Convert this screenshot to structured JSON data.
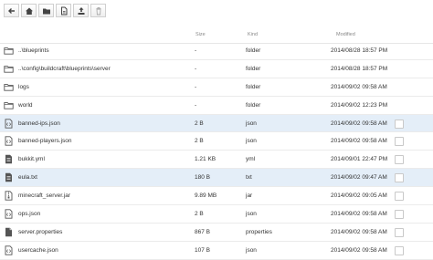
{
  "toolbar": {
    "buttons": [
      {
        "icon": "back-arrow-icon"
      },
      {
        "icon": "home-icon"
      },
      {
        "icon": "folder-icon"
      },
      {
        "icon": "new-file-icon"
      },
      {
        "icon": "upload-icon"
      },
      {
        "icon": "trash-icon"
      }
    ]
  },
  "columns": {
    "size": "Size",
    "kind": "Kind",
    "modified": "Modified"
  },
  "files": [
    {
      "name": "..\\blueprints",
      "size": "-",
      "kind": "folder",
      "modified": "2014/08/28 18:57 PM",
      "icon": "folder-icon",
      "highlighted": false,
      "has_checkbox": false
    },
    {
      "name": "..\\config\\buildcraft\\blueprints\\server",
      "size": "-",
      "kind": "folder",
      "modified": "2014/08/28 18:57 PM",
      "icon": "folder-icon",
      "highlighted": false,
      "has_checkbox": false
    },
    {
      "name": "logs",
      "size": "-",
      "kind": "folder",
      "modified": "2014/09/02 09:58 AM",
      "icon": "folder-icon",
      "highlighted": false,
      "has_checkbox": false
    },
    {
      "name": "world",
      "size": "-",
      "kind": "folder",
      "modified": "2014/09/02 12:23 PM",
      "icon": "folder-icon",
      "highlighted": false,
      "has_checkbox": false
    },
    {
      "name": "banned-ips.json",
      "size": "2 B",
      "kind": "json",
      "modified": "2014/09/02 09:58 AM",
      "icon": "code-file-icon",
      "highlighted": true,
      "has_checkbox": true
    },
    {
      "name": "banned-players.json",
      "size": "2 B",
      "kind": "json",
      "modified": "2014/09/02 09:58 AM",
      "icon": "code-file-icon",
      "highlighted": false,
      "has_checkbox": true
    },
    {
      "name": "bukkit.yml",
      "size": "1.21 KB",
      "kind": "yml",
      "modified": "2014/09/01 22:47 PM",
      "icon": "text-file-icon",
      "highlighted": false,
      "has_checkbox": true
    },
    {
      "name": "eula.txt",
      "size": "180 B",
      "kind": "txt",
      "modified": "2014/09/02 09:47 AM",
      "icon": "text-file-icon",
      "highlighted": true,
      "has_checkbox": true
    },
    {
      "name": "minecraft_server.jar",
      "size": "9.89 MB",
      "kind": "jar",
      "modified": "2014/09/02 09:05 AM",
      "icon": "archive-file-icon",
      "highlighted": false,
      "has_checkbox": true
    },
    {
      "name": "ops.json",
      "size": "2 B",
      "kind": "json",
      "modified": "2014/09/02 09:58 AM",
      "icon": "code-file-icon",
      "highlighted": false,
      "has_checkbox": true
    },
    {
      "name": "server.properties",
      "size": "867 B",
      "kind": "properties",
      "modified": "2014/09/02 09:58 AM",
      "icon": "generic-file-icon",
      "highlighted": false,
      "has_checkbox": true
    },
    {
      "name": "usercache.json",
      "size": "107 B",
      "kind": "json",
      "modified": "2014/09/02 09:58 AM",
      "icon": "code-file-icon",
      "highlighted": false,
      "has_checkbox": true
    }
  ],
  "colors": {
    "highlight_row": "#e4eef8",
    "divider": "#ebebeb",
    "icon": "#555555"
  }
}
